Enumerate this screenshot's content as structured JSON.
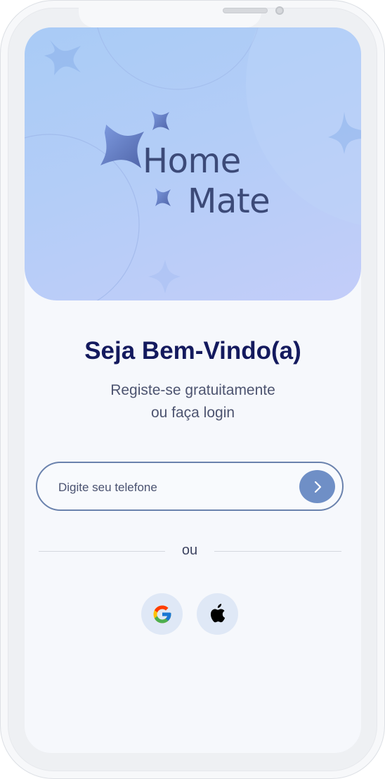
{
  "app": {
    "logo_line1": "Home",
    "logo_line2": "Mate"
  },
  "welcome": {
    "title": "Seja Bem-Vindo(a)",
    "subtitle_line1": "Registe-se gratuitamente",
    "subtitle_line2": "ou faça login"
  },
  "phone_input": {
    "placeholder": "Digite seu telefone",
    "value": "",
    "submit_icon": "chevron-right-icon"
  },
  "divider": {
    "label": "ou"
  },
  "social_login": [
    {
      "provider": "Google",
      "icon": "google-icon"
    },
    {
      "provider": "Apple",
      "icon": "apple-icon"
    }
  ],
  "colors": {
    "title": "#141a5e",
    "logo": "#3c4a78",
    "hero_gradient_start": "#a9cbf6",
    "hero_gradient_end": "#c3cdf9",
    "submit_button": "#6f8fc6",
    "input_border": "#6a82ad",
    "social_button_bg": "#dfe8f6"
  }
}
